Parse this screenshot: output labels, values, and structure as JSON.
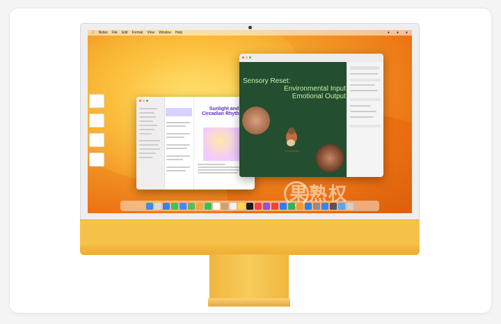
{
  "colors": {
    "chin": "#f7c24a",
    "notes_accent": "#5a2ad0",
    "pages_green": "#234e2f",
    "pages_text": "#c8f0a8"
  },
  "menubar": {
    "items": [
      "",
      "Notes",
      "File",
      "Edit",
      "Format",
      "View",
      "Window",
      "Help"
    ]
  },
  "notes": {
    "title_line1": "Sunlight and",
    "title_line2": "Circadian Rhythms",
    "subtitle": "",
    "sidebar_label": "",
    "list_items": [],
    "caption_heading": "",
    "caption_body": ""
  },
  "pages": {
    "header_left": "",
    "header_mid": "",
    "header_date": "",
    "header_right": "",
    "title_line1": "Sensory Reset:",
    "title_line2": "Environmental Input",
    "title_line3": "Emotional Output"
  },
  "watermark": {
    "text": "果熟权"
  },
  "dock": {
    "icons": [
      "finder-icon",
      "launchpad-icon",
      "safari-icon",
      "messages-icon",
      "mail-icon",
      "maps-icon",
      "photos-icon",
      "facetime-icon",
      "calendar-icon",
      "contacts-icon",
      "reminders-icon",
      "notes-icon",
      "tv-icon",
      "music-icon",
      "podcasts-icon",
      "news-icon",
      "keynote-icon",
      "numbers-icon",
      "pages-icon",
      "appstore-icon",
      "settings-icon",
      "safari-2-icon",
      "camera-icon",
      "folder-icon",
      "trash-icon"
    ]
  }
}
